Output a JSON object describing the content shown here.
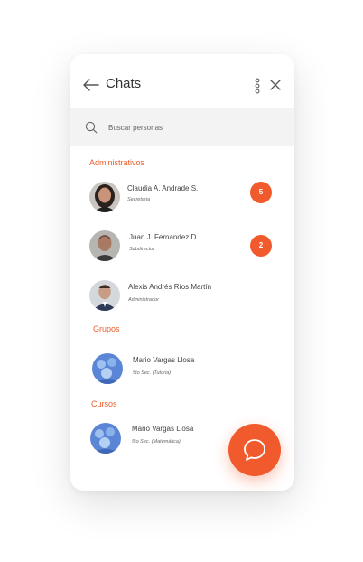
{
  "header": {
    "title": "Chats"
  },
  "search": {
    "placeholder": "Buscar personas"
  },
  "sections": {
    "administrativos": "Administrativos",
    "grupos": "Grupos",
    "cursos": "Cursos"
  },
  "contacts": [
    {
      "name": "Claudia A. Andrade S.",
      "role": "Secretaria",
      "unread": "5"
    },
    {
      "name": "Juan J. Fernandez D.",
      "role": "Subdirector",
      "unread": "2"
    },
    {
      "name": "Alexis Andrés Ríos Martín",
      "role": "Administrador"
    }
  ],
  "groups": [
    {
      "name": "Mario Vargas Llosa",
      "role": "5to Sec. (Tutoria)"
    }
  ],
  "courses": [
    {
      "name": "Mario Vargas Llosa",
      "role": "5to Sec. (Matemática)"
    }
  ],
  "colors": {
    "accent": "#f15a2c",
    "section_title": "#e95c2b",
    "search_bg": "#f3f3f3"
  },
  "icons": {
    "back": "arrow-left-icon",
    "more": "vertical-dots-icon",
    "close": "close-icon",
    "search": "search-icon",
    "fab": "chat-bubble-icon"
  }
}
